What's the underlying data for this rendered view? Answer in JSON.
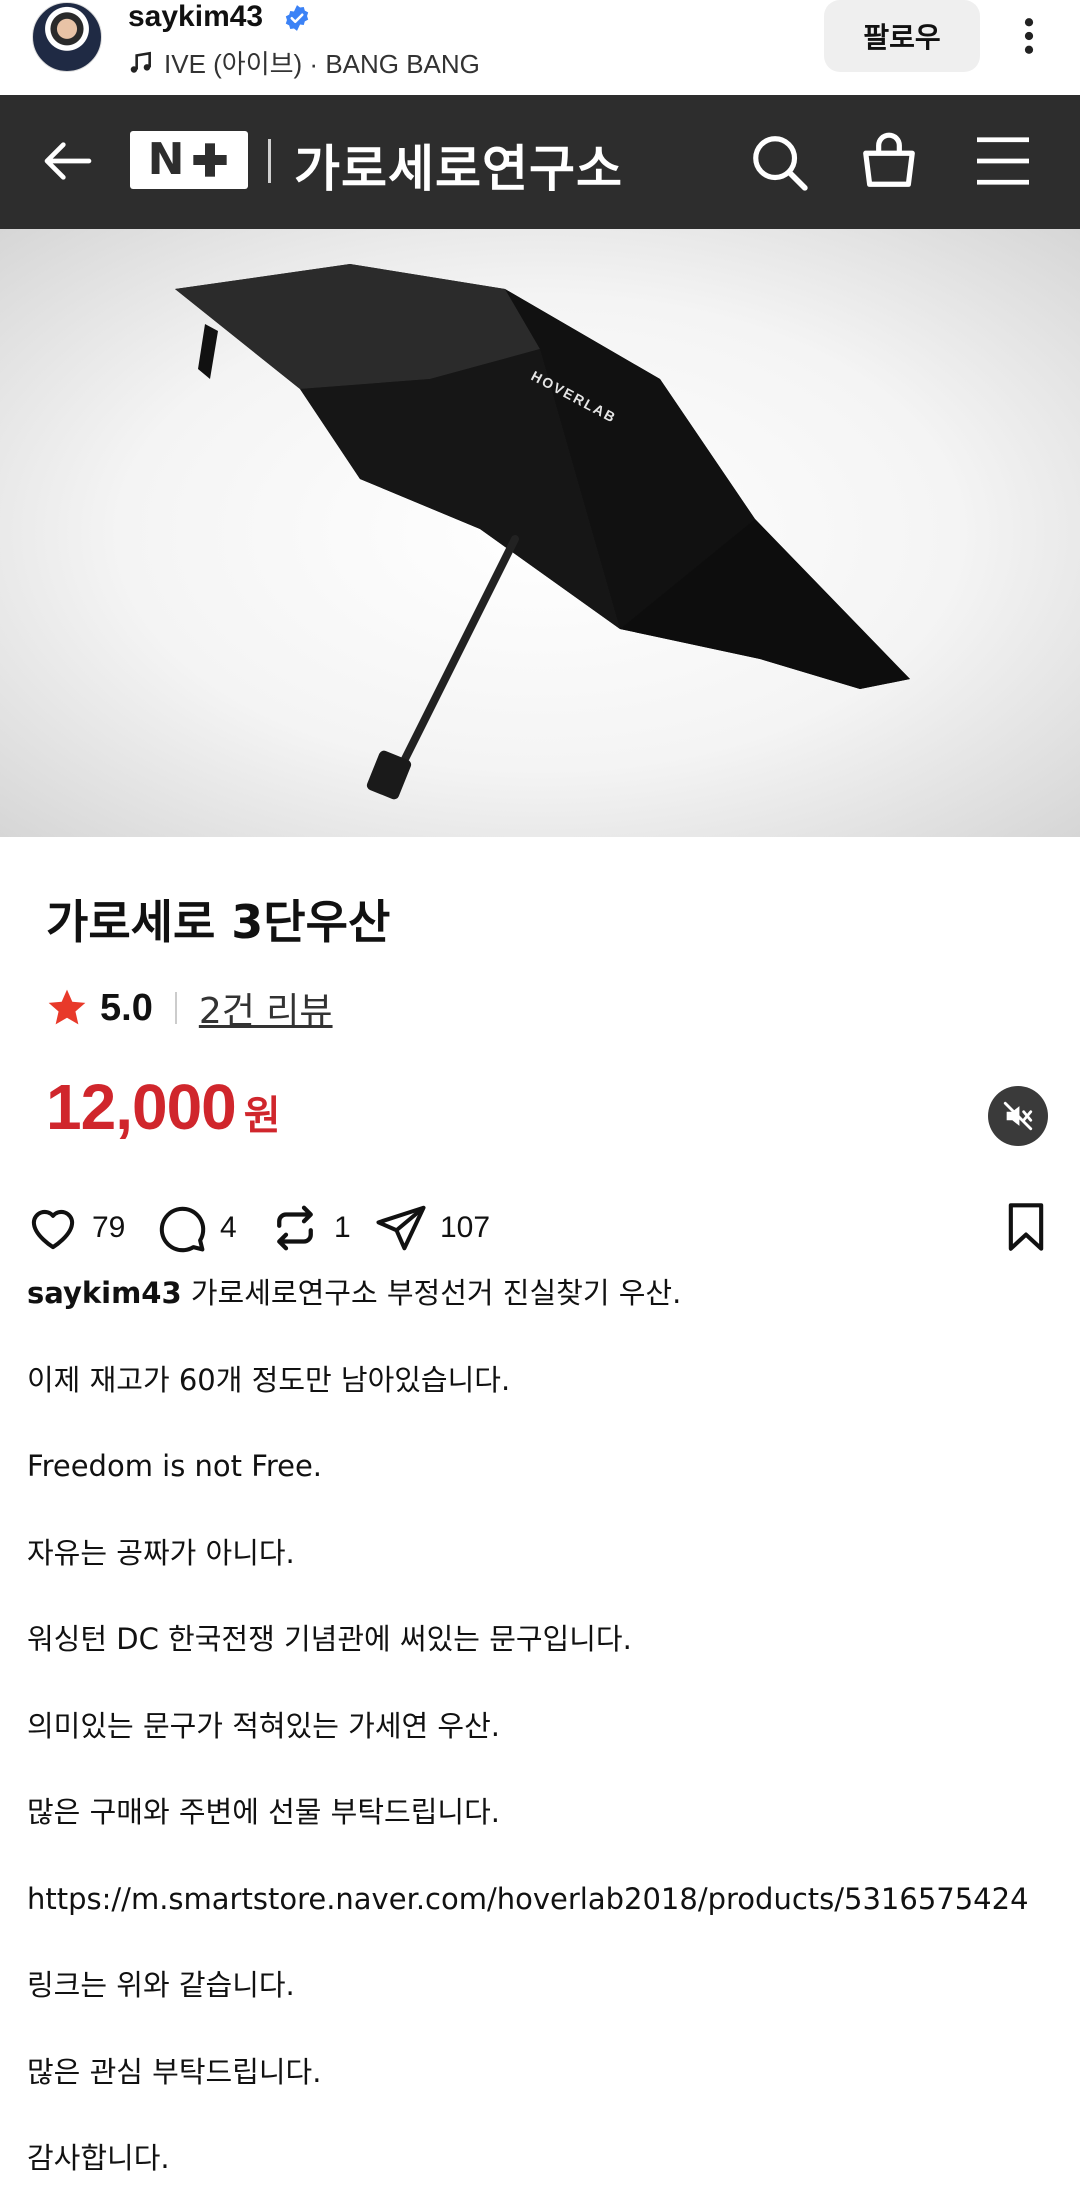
{
  "post": {
    "username": "saykim43",
    "music": "IVE (아이브) · BANG BANG",
    "follow_label": "팔로우"
  },
  "store": {
    "logo_letter": "N",
    "name": "가로세로연구소"
  },
  "product": {
    "image_brand_text": "HOVERLAB",
    "title": "가로세로 3단우산",
    "rating": "5.0",
    "review_link": "2건 리뷰",
    "price": "12,000",
    "price_unit": "원"
  },
  "actions": {
    "likes": "79",
    "comments": "4",
    "reposts": "1",
    "shares": "107"
  },
  "caption": {
    "author": "saykim43",
    "first_line": " 가로세로연구소 부정선거 진실찾기 우산.",
    "lines": [
      "이제 재고가 60개 정도만 남아있습니다.",
      "Freedom is not Free.",
      "자유는 공짜가 아니다.",
      "워싱턴 DC 한국전쟁 기념관에 써있는 문구입니다.",
      "의미있는 문구가 적혀있는 가세연 우산.",
      "많은 구매와 주변에 선물 부탁드립니다.",
      "https://m.smartstore.naver.com/hoverlab2018/products/5316575424",
      "링크는 위와 같습니다.",
      "많은 관심 부탁드립니다.",
      "감사합니다."
    ]
  },
  "colors": {
    "nav_background": "#2d2d2d",
    "price_red": "#d0262c",
    "star_red": "#e8392a",
    "verified_blue": "#3b82f6"
  },
  "icons": {
    "verified": "verified-badge-icon",
    "music": "music-note-icon",
    "more": "more-vertical-icon",
    "back": "back-arrow-icon",
    "search": "search-icon",
    "bag": "shopping-bag-icon",
    "menu": "hamburger-menu-icon",
    "star": "star-icon",
    "mute": "speaker-muted-icon",
    "like": "heart-icon",
    "comment": "comment-icon",
    "repost": "repost-icon",
    "share": "send-icon",
    "bookmark": "bookmark-icon"
  }
}
